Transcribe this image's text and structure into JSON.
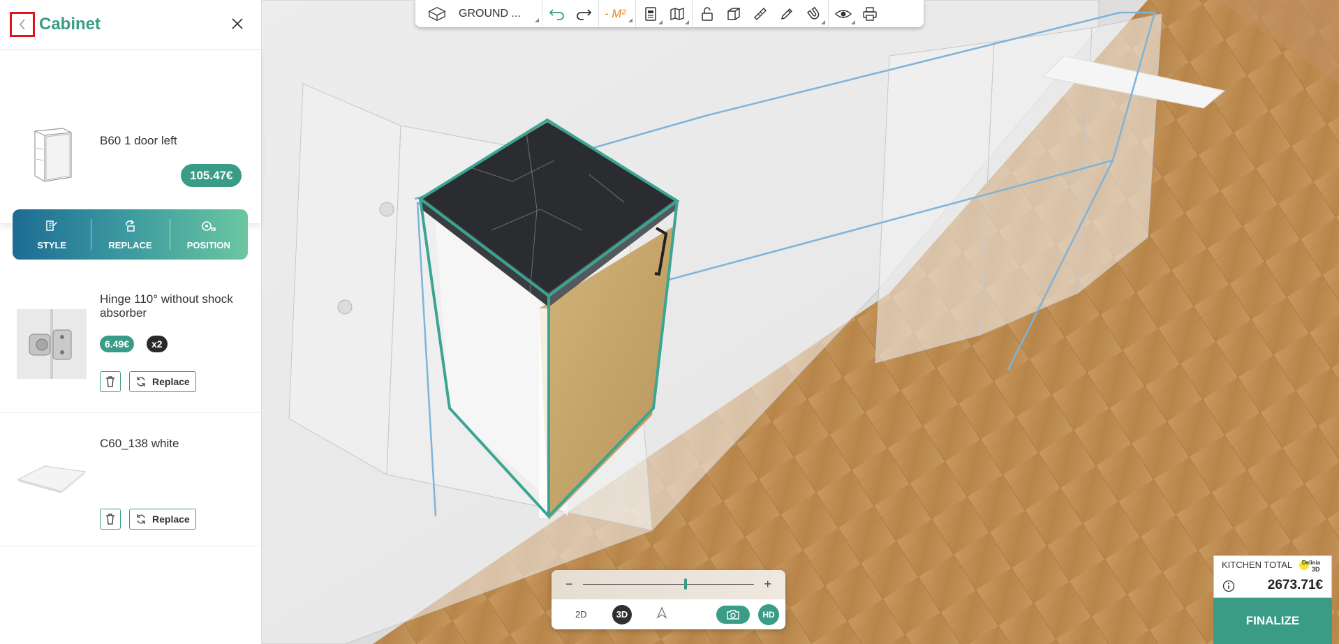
{
  "sidebar": {
    "title": "Cabinet",
    "cabinet": {
      "name": "B60 1 door left",
      "price": "105.47€"
    },
    "actions": [
      "STYLE",
      "REPLACE",
      "POSITION"
    ],
    "items": [
      {
        "name": "Hinge 110° without shock absorber",
        "price": "6.49€",
        "qty": "x2",
        "replace_label": "Replace"
      },
      {
        "name": "C60_138 white",
        "replace_label": "Replace"
      }
    ]
  },
  "toolbar": {
    "floor_label": "GROUND ...",
    "area_label": "- M²",
    "icons": [
      "cube-outline-icon",
      "undo-icon",
      "redo-icon",
      "area-icon",
      "document-icon",
      "map-icon",
      "unlock-icon",
      "box-3d-icon",
      "ruler-icon",
      "pencil-icon",
      "magnet-icon",
      "eye-icon",
      "print-icon"
    ]
  },
  "zoom": {
    "level": 0.6,
    "minus": "−",
    "plus": "+",
    "mode_2d": "2D",
    "mode_3d": "3D",
    "hd": "HD"
  },
  "total": {
    "label": "KITCHEN TOTAL",
    "value": "2673.71€",
    "finalize_label": "FINALIZE",
    "brand": "Delinia 3D"
  },
  "colors": {
    "accent": "#3a9c86",
    "back_highlight": "#e0141c",
    "area": "#e8821e",
    "wireframe_blue": "#7fb3d8"
  }
}
